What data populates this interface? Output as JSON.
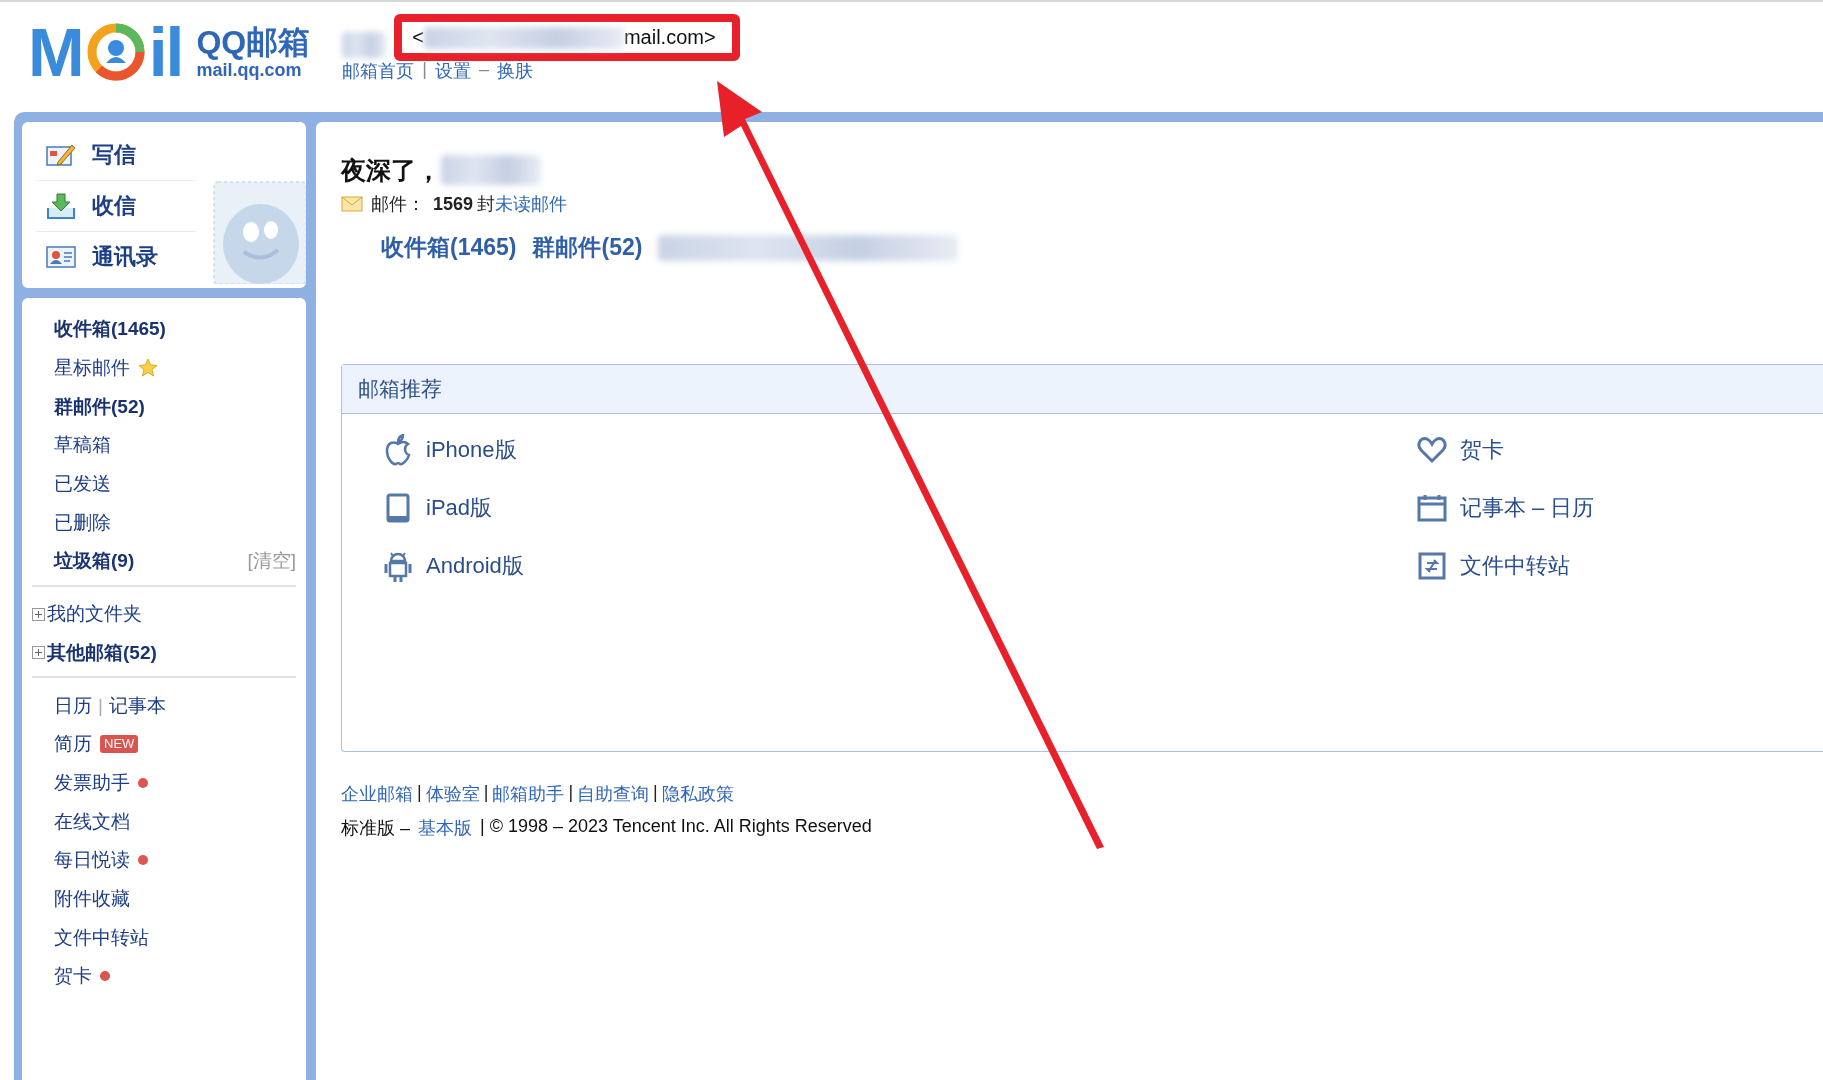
{
  "header": {
    "logo_letters": [
      "M",
      "il"
    ],
    "logo_title": "QQ邮箱",
    "logo_domain": "mail.qq.com",
    "email_prefix": "<",
    "email_suffix": "mail.com>",
    "links": [
      {
        "label": "邮箱首页"
      },
      {
        "sep": "|",
        "label": "设置"
      },
      {
        "sep": "–",
        "label": "换肤"
      }
    ]
  },
  "quick_actions": [
    {
      "label": "写信",
      "kind": "compose"
    },
    {
      "label": "收信",
      "kind": "receive"
    },
    {
      "label": "通讯录",
      "kind": "contacts"
    }
  ],
  "folders": [
    {
      "kind": "folder",
      "label": "收件箱(1465)",
      "bold": true
    },
    {
      "kind": "folder",
      "label": "星标邮件",
      "bold": false,
      "star": true
    },
    {
      "kind": "folder",
      "label": "群邮件(52)",
      "bold": true
    },
    {
      "kind": "folder",
      "label": "草稿箱",
      "bold": false
    },
    {
      "kind": "folder",
      "label": "已发送",
      "bold": false
    },
    {
      "kind": "folder",
      "label": "已删除",
      "bold": false
    },
    {
      "kind": "folder",
      "label": "垃圾箱(9)",
      "bold": true,
      "action": "[清空]"
    },
    {
      "kind": "divider"
    },
    {
      "kind": "group",
      "label": "我的文件夹",
      "bold": false,
      "expanded": false
    },
    {
      "kind": "group",
      "label": "其他邮箱(52)",
      "bold": true,
      "expanded": false
    },
    {
      "kind": "divider"
    },
    {
      "kind": "pair",
      "labels": [
        "日历",
        "记事本"
      ],
      "sep": "|"
    },
    {
      "kind": "folder",
      "label": "简历",
      "bold": false,
      "badge": "NEW"
    },
    {
      "kind": "folder",
      "label": "发票助手",
      "bold": false,
      "dot": true
    },
    {
      "kind": "folder",
      "label": "在线文档",
      "bold": false
    },
    {
      "kind": "folder",
      "label": "每日悦读",
      "bold": false,
      "dot": true
    },
    {
      "kind": "folder",
      "label": "附件收藏",
      "bold": false
    },
    {
      "kind": "folder",
      "label": "文件中转站",
      "bold": false
    },
    {
      "kind": "folder",
      "label": "贺卡",
      "bold": false,
      "dot": true
    }
  ],
  "greeting": "夜深了，",
  "mail_summary": {
    "label": "邮件：",
    "count": "1569",
    "unit": "封",
    "link": "未读邮件"
  },
  "shortcuts": [
    "收件箱(1465)",
    "群邮件(52)"
  ],
  "recommend": {
    "title": "邮箱推荐",
    "columns": [
      [
        {
          "label": "iPhone版",
          "kind": "apple"
        },
        {
          "label": "iPad版",
          "kind": "tablet"
        },
        {
          "label": "Android版",
          "kind": "android"
        }
      ],
      [
        {
          "label": "贺卡",
          "kind": "heart"
        },
        {
          "label": "记事本 – 日历",
          "kind": "calendar"
        },
        {
          "label": "文件中转站",
          "kind": "transfer"
        }
      ]
    ]
  },
  "footer": {
    "links": [
      {
        "label": "企业邮箱"
      },
      {
        "sep": "|",
        "label": "体验室"
      },
      {
        "sep": "|",
        "label": "邮箱助手"
      },
      {
        "sep": "|",
        "label": "自助查询"
      },
      {
        "sep": "|",
        "label": "隐私政策"
      }
    ],
    "edition": "标准版 –",
    "basic_link": "基本版",
    "copyright": "| © 1998 – 2023 Tencent Inc. All Rights Reserved"
  }
}
